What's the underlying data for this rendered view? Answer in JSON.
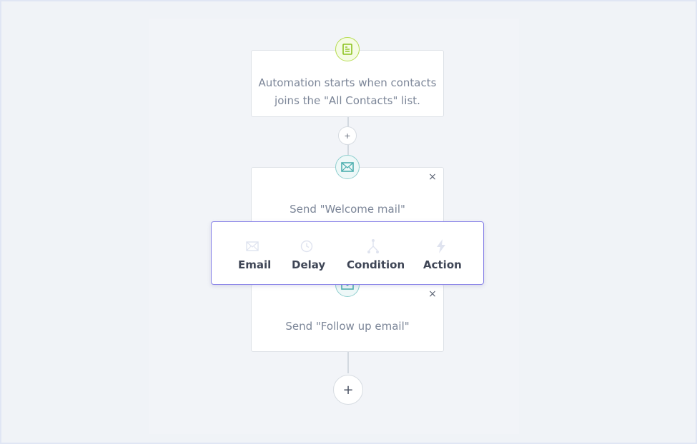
{
  "trigger": {
    "icon": "list-document-icon",
    "line1": "Automation starts when contacts",
    "line2": "joins the \"All Contacts\" list."
  },
  "steps": [
    {
      "icon": "envelope-icon",
      "label": "Send \"Welcome mail\"",
      "close": "×"
    },
    {
      "icon": "envelope-icon",
      "label": "Send \"Follow up email\"",
      "close": "×"
    }
  ],
  "add_step_small": "+",
  "add_step_end": "+",
  "menu": {
    "options": [
      {
        "label": "Email",
        "icon": "envelope-icon"
      },
      {
        "label": "Delay",
        "icon": "clock-icon"
      },
      {
        "label": "Condition",
        "icon": "branch-icon"
      },
      {
        "label": "Action",
        "icon": "lightning-icon"
      }
    ]
  },
  "colors": {
    "trigger_accent": "#b6dc4f",
    "email_accent": "#8fcfcf",
    "menu_border": "#8b85e8"
  }
}
